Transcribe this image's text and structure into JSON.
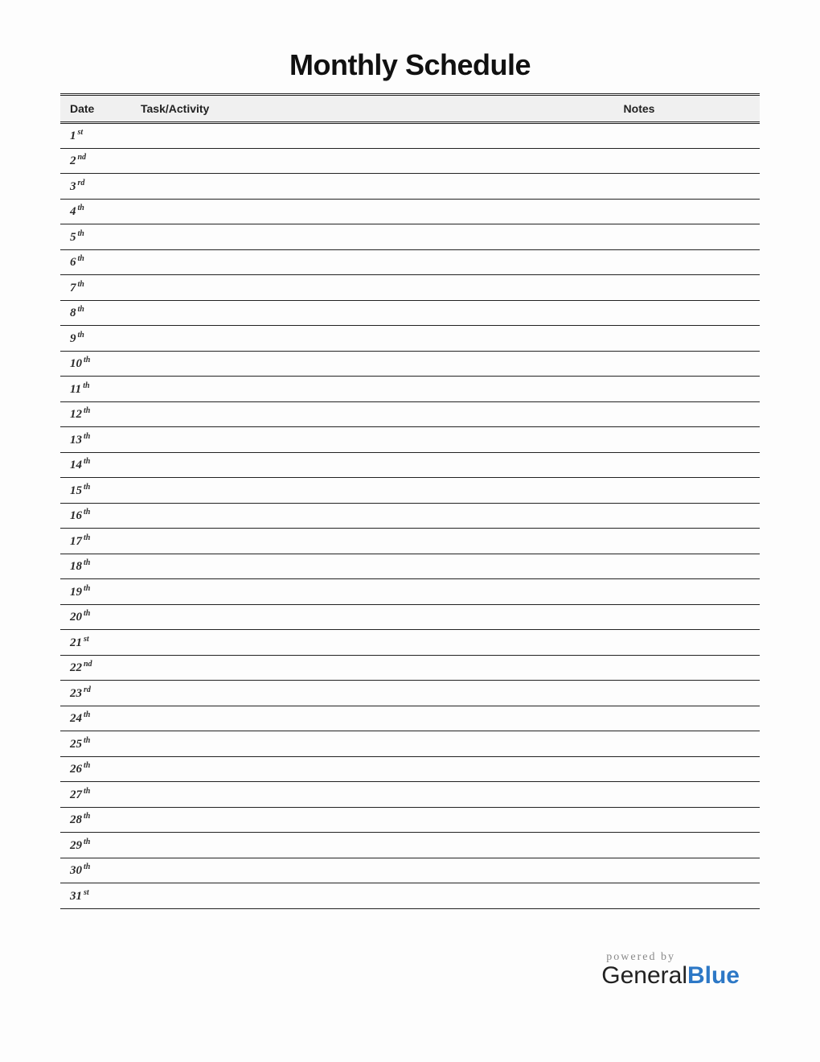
{
  "title": "Monthly Schedule",
  "columns": {
    "date": "Date",
    "task": "Task/Activity",
    "notes": "Notes"
  },
  "rows": [
    {
      "day": "1",
      "ordinal": "st",
      "task": "",
      "notes": ""
    },
    {
      "day": "2",
      "ordinal": "nd",
      "task": "",
      "notes": ""
    },
    {
      "day": "3",
      "ordinal": "rd",
      "task": "",
      "notes": ""
    },
    {
      "day": "4",
      "ordinal": "th",
      "task": "",
      "notes": ""
    },
    {
      "day": "5",
      "ordinal": "th",
      "task": "",
      "notes": ""
    },
    {
      "day": "6",
      "ordinal": "th",
      "task": "",
      "notes": ""
    },
    {
      "day": "7",
      "ordinal": "th",
      "task": "",
      "notes": ""
    },
    {
      "day": "8",
      "ordinal": "th",
      "task": "",
      "notes": ""
    },
    {
      "day": "9",
      "ordinal": "th",
      "task": "",
      "notes": ""
    },
    {
      "day": "10",
      "ordinal": "th",
      "task": "",
      "notes": ""
    },
    {
      "day": "11",
      "ordinal": "th",
      "task": "",
      "notes": ""
    },
    {
      "day": "12",
      "ordinal": "th",
      "task": "",
      "notes": ""
    },
    {
      "day": "13",
      "ordinal": "th",
      "task": "",
      "notes": ""
    },
    {
      "day": "14",
      "ordinal": "th",
      "task": "",
      "notes": ""
    },
    {
      "day": "15",
      "ordinal": "th",
      "task": "",
      "notes": ""
    },
    {
      "day": "16",
      "ordinal": "th",
      "task": "",
      "notes": ""
    },
    {
      "day": "17",
      "ordinal": "th",
      "task": "",
      "notes": ""
    },
    {
      "day": "18",
      "ordinal": "th",
      "task": "",
      "notes": ""
    },
    {
      "day": "19",
      "ordinal": "th",
      "task": "",
      "notes": ""
    },
    {
      "day": "20",
      "ordinal": "th",
      "task": "",
      "notes": ""
    },
    {
      "day": "21",
      "ordinal": "st",
      "task": "",
      "notes": ""
    },
    {
      "day": "22",
      "ordinal": "nd",
      "task": "",
      "notes": ""
    },
    {
      "day": "23",
      "ordinal": "rd",
      "task": "",
      "notes": ""
    },
    {
      "day": "24",
      "ordinal": "th",
      "task": "",
      "notes": ""
    },
    {
      "day": "25",
      "ordinal": "th",
      "task": "",
      "notes": ""
    },
    {
      "day": "26",
      "ordinal": "th",
      "task": "",
      "notes": ""
    },
    {
      "day": "27",
      "ordinal": "th",
      "task": "",
      "notes": ""
    },
    {
      "day": "28",
      "ordinal": "th",
      "task": "",
      "notes": ""
    },
    {
      "day": "29",
      "ordinal": "th",
      "task": "",
      "notes": ""
    },
    {
      "day": "30",
      "ordinal": "th",
      "task": "",
      "notes": ""
    },
    {
      "day": "31",
      "ordinal": "st",
      "task": "",
      "notes": ""
    }
  ],
  "footer": {
    "powered_by": "powered by",
    "brand_a": "General",
    "brand_b": "Blue"
  }
}
